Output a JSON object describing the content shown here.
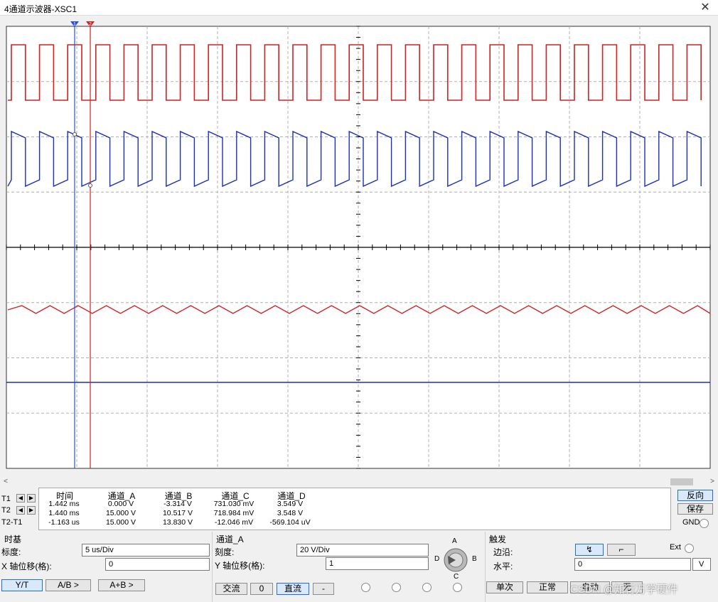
{
  "window": {
    "title": "4通道示波器-XSC1",
    "close": "✕"
  },
  "colors": {
    "channel_a": "#d42020",
    "channel_b": "#1c2fc0",
    "grid": "#b0b0b0",
    "cursor_t1": "#2a4fd0",
    "cursor_t2": "#d02020"
  },
  "cursors": {
    "t1_marker": "1",
    "t2_marker": "2"
  },
  "readout": {
    "headers": [
      "时间",
      "通道_A",
      "通道_B",
      "通道_C",
      "通道_D"
    ],
    "row_labels": [
      "T1",
      "T2",
      "T2-T1"
    ],
    "rows": [
      [
        "1.442 ms",
        "0.000 V",
        "-3.314 V",
        "731.030 mV",
        "3.549 V"
      ],
      [
        "1.440 ms",
        "15.000 V",
        "10.517 V",
        "718.984 mV",
        "3.548 V"
      ],
      [
        "-1.163 us",
        "15.000 V",
        "13.830 V",
        "-12.046 mV",
        "-569.104 uV"
      ]
    ],
    "reverse_button": "反向",
    "save_button": "保存",
    "gnd_label": "GND"
  },
  "timebase": {
    "title": "时基",
    "scale_label": "标度:",
    "scale_value": "5 us/Div",
    "xpos_label": "X 轴位移(格):",
    "xpos_value": "0",
    "buttons": [
      "Y/T",
      "A/B >",
      "A+B >"
    ]
  },
  "channel": {
    "title": "通道_A",
    "scale_label": "刻度:",
    "scale_value": "20  V/Div",
    "ypos_label": "Y 轴位移(格):",
    "ypos_value": "1",
    "buttons": [
      "交流",
      "0",
      "直流",
      "-"
    ],
    "selector_labels": [
      "A",
      "B",
      "C",
      "D"
    ]
  },
  "trigger": {
    "title": "触发",
    "edge_label": "边沿:",
    "edge_rising": "↯",
    "edge_falling": "⌐",
    "ext_label": "Ext",
    "level_label": "水平:",
    "level_value": "0",
    "level_unit": "V",
    "buttons": [
      "单次",
      "正常",
      "自动",
      "无"
    ]
  },
  "watermark": "CSDN @知行万学硬件"
}
